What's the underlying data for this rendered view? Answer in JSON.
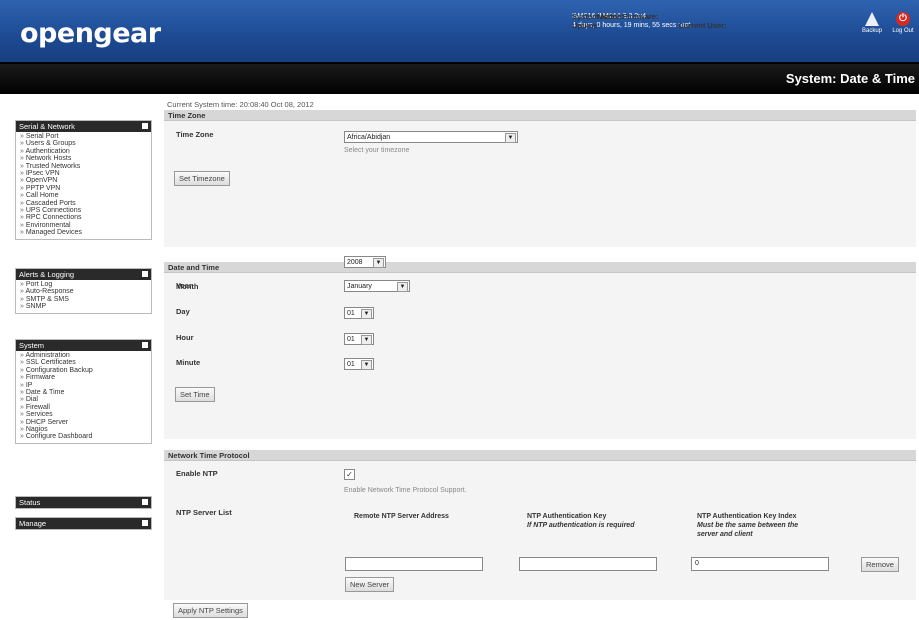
{
  "header": {
    "logo": "opengear",
    "system_name_label": "System Name:",
    "system_name": "IM4216",
    "model_label": "Model:",
    "model": "IM4216",
    "firmware_label": "Firmware:",
    "firmware": "3.3.2u4",
    "uptime_label": "Uptime:",
    "uptime": "4 days, 0 hours, 19 mins, 55 secs",
    "current_user_label": "Current User:",
    "current_user": "root",
    "backup_label": "Backup",
    "logout_label": "Log Out"
  },
  "page_title": "System: Date & Time",
  "sidebar": {
    "serial_network": {
      "title": "Serial & Network",
      "items": [
        "Serial Port",
        "Users & Groups",
        "Authentication",
        "Network Hosts",
        "Trusted Networks",
        "IPsec VPN",
        "OpenVPN",
        "PPTP VPN",
        "Call Home",
        "Cascaded Ports",
        "UPS Connections",
        "RPC Connections",
        "Environmental",
        "Managed Devices"
      ]
    },
    "alerts_logging": {
      "title": "Alerts & Logging",
      "items": [
        "Port Log",
        "Auto-Response",
        "SMTP & SMS",
        "SNMP"
      ]
    },
    "system": {
      "title": "System",
      "items": [
        "Administration",
        "SSL Certificates",
        "Configuration Backup",
        "Firmware",
        "IP",
        "Date & Time",
        "Dial",
        "Firewall",
        "Services",
        "DHCP Server",
        "Nagios",
        "Configure Dashboard"
      ]
    },
    "status": {
      "title": "Status"
    },
    "manage": {
      "title": "Manage"
    }
  },
  "main": {
    "current_time": "Current System time: 20:08:40 Oct 08, 2012",
    "timezone_section": {
      "title": "Time Zone",
      "label": "Time Zone",
      "value": "Africa/Abidjan",
      "hint": "Select your timezone",
      "button": "Set Timezone"
    },
    "datetime_section": {
      "title": "Date and Time",
      "year_label": "Year",
      "year": "2008",
      "month_label": "Month",
      "month": "January",
      "day_label": "Day",
      "day": "01",
      "hour_label": "Hour",
      "hour": "01",
      "minute_label": "Minute",
      "minute": "01",
      "button": "Set Time"
    },
    "ntp_section": {
      "title": "Network Time Protocol",
      "enable_label": "Enable NTP",
      "enable_checked": true,
      "enable_hint": "Enable Network Time Protocol Support.",
      "server_list_label": "NTP Server List",
      "col_address": "Remote NTP Server Address",
      "col_key": "NTP Authentication Key",
      "col_key_sub": "If NTP authentication is required",
      "col_index": "NTP Authentication Key Index",
      "col_index_sub1": "Must be the same between the",
      "col_index_sub2": "server and client",
      "address_value": "",
      "key_value": "",
      "index_value": "0",
      "remove_button": "Remove",
      "new_server_button": "New Server",
      "apply_button": "Apply NTP Settings"
    }
  },
  "colors": {
    "header_blue": "#1d4a92",
    "titlebar_black": "#000000",
    "section_head_gray": "#d7d7d7",
    "logout_red": "#d8281f"
  }
}
